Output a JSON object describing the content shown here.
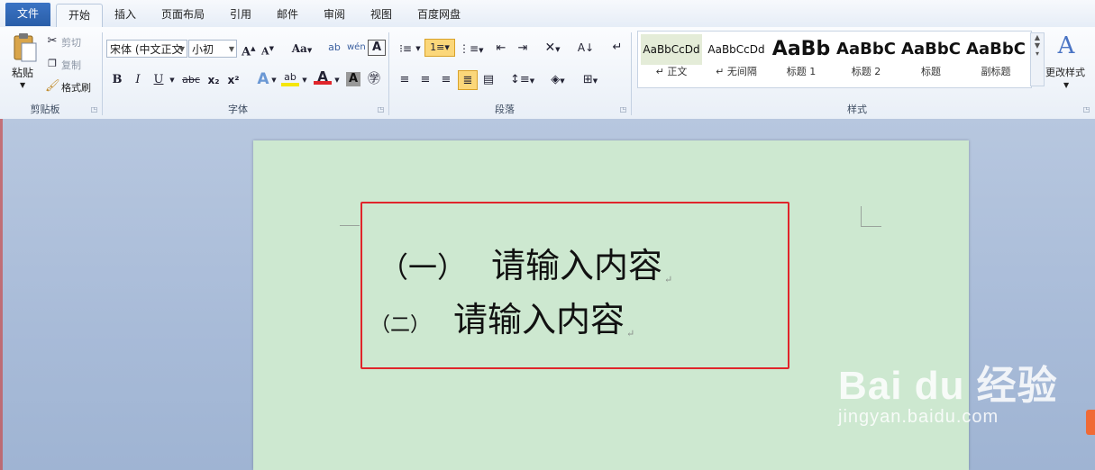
{
  "tabs": {
    "file": "文件",
    "home": "开始",
    "insert": "插入",
    "page_layout": "页面布局",
    "references": "引用",
    "mailings": "邮件",
    "review": "审阅",
    "view": "视图",
    "baidu_netdisk": "百度网盘"
  },
  "clipboard": {
    "paste": "粘贴",
    "cut": "剪切",
    "copy": "复制",
    "format_painter": "格式刷",
    "group_label": "剪贴板"
  },
  "font": {
    "font_name": "宋体 (中文正文",
    "font_size": "小初",
    "grow": "A",
    "shrink": "A",
    "change_case": "Aa",
    "bold": "B",
    "italic": "I",
    "underline": "U",
    "strikethrough": "abc",
    "subscript": "x₂",
    "superscript": "x²",
    "group_label": "字体"
  },
  "paragraph": {
    "group_label": "段落"
  },
  "styles": {
    "items": [
      {
        "preview": "AaBbCcDd",
        "label": "↵ 正文"
      },
      {
        "preview": "AaBbCcDd",
        "label": "↵ 无间隔"
      },
      {
        "preview": "AaBb",
        "label": "标题 1"
      },
      {
        "preview": "AaBbC",
        "label": "标题 2"
      },
      {
        "preview": "AaBbC",
        "label": "标题"
      },
      {
        "preview": "AaBbC",
        "label": "副标题"
      }
    ],
    "change_styles": "更改样式",
    "group_label": "样式"
  },
  "document": {
    "line1_prefix": "（一）",
    "line1_text": "请输入内容",
    "line2_prefix": "（二）",
    "line2_text": "请输入内容",
    "paragraph_mark": "↵"
  },
  "watermark": {
    "brand": "Bai du 经验",
    "url": "jingyan.baidu.com"
  },
  "colors": {
    "file_tab": "#2a5ea8",
    "page_background": "#cde8d0",
    "highlight_box": "#e0252b",
    "font_color_bar": "#e0252b",
    "highlight_color_bar": "#f5e60a"
  }
}
